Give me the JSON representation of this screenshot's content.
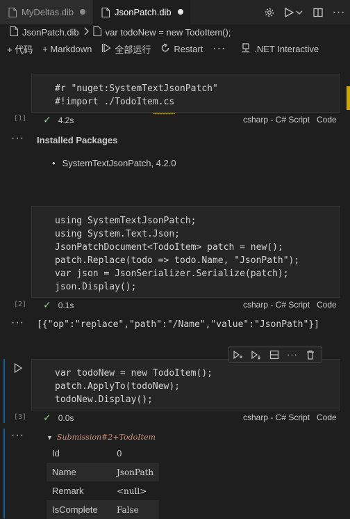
{
  "tabs": [
    {
      "label": "MyDeltas.dib",
      "dirty": true
    },
    {
      "label": "JsonPatch.dib",
      "dirty": true
    }
  ],
  "breadcrumb": {
    "file": "JsonPatch.dib",
    "symbol": "var todoNew = new TodoItem();"
  },
  "toolbar": {
    "add_code": "+ 代码",
    "add_markdown": "+ Markdown",
    "run_all": "全部运行",
    "restart": "Restart",
    "more": "···",
    "kernel": ".NET Interactive"
  },
  "cells": [
    {
      "number": "[1]",
      "lines": [
        "#r \"nuget:SystemTextJsonPatch\"",
        "#!import ./TodoItem.cs"
      ],
      "duration": "4.2s",
      "language": "csharp - C# Script",
      "mode": "Code"
    },
    {
      "number": "[2]",
      "lines": [
        "using SystemTextJsonPatch;",
        "using System.Text.Json;",
        "JsonPatchDocument<TodoItem> patch = new();",
        "patch.Replace(todo => todo.Name, \"JsonPath\");",
        "var json = JsonSerializer.Serialize(patch);",
        "json.Display();"
      ],
      "duration": "0.1s",
      "language": "csharp - C# Script",
      "mode": "Code"
    },
    {
      "number": "[3]",
      "lines": [
        "var todoNew = new TodoItem();",
        "patch.ApplyTo(todoNew);",
        "todoNew.Display();"
      ],
      "duration": "0.0s",
      "language": "csharp - C# Script",
      "mode": "Code"
    }
  ],
  "output1": {
    "title": "Installed Packages",
    "items": [
      "SystemTextJsonPatch, 4.2.0"
    ]
  },
  "output2": {
    "text": "[{\"op\":\"replace\",\"path\":\"/Name\",\"value\":\"JsonPath\"}]"
  },
  "output3": {
    "type_name": "Submission#2+TodoItem",
    "rows": [
      {
        "key": "Id",
        "value": "0"
      },
      {
        "key": "Name",
        "value": "JsonPath"
      },
      {
        "key": "Remark",
        "value": "<null>"
      },
      {
        "key": "IsComplete",
        "value": "False"
      }
    ]
  },
  "colors": {
    "accent": "#0e639c",
    "success": "#89d185",
    "warning": "#cca700",
    "string": "#ce9178",
    "bracket": "#ffd700"
  }
}
